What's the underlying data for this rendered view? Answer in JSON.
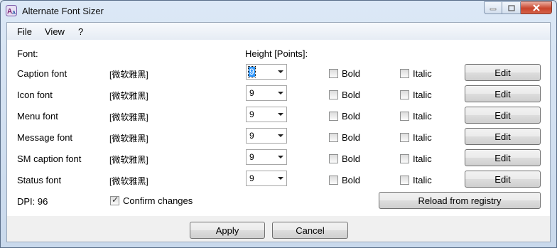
{
  "window": {
    "title": "Alternate Font Sizer"
  },
  "menu": {
    "file": "File",
    "view": "View",
    "help": "?"
  },
  "headers": {
    "font": "Font:",
    "height": "Height [Points]:"
  },
  "labels": {
    "bold": "Bold",
    "italic": "Italic",
    "edit": "Edit"
  },
  "rows": [
    {
      "label": "Caption font",
      "font": "[微软雅黑]",
      "height": "9",
      "bold": false,
      "italic": false
    },
    {
      "label": "Icon font",
      "font": "[微软雅黑]",
      "height": "9",
      "bold": false,
      "italic": false
    },
    {
      "label": "Menu font",
      "font": "[微软雅黑]",
      "height": "9",
      "bold": false,
      "italic": false
    },
    {
      "label": "Message font",
      "font": "[微软雅黑]",
      "height": "9",
      "bold": false,
      "italic": false
    },
    {
      "label": "SM caption font",
      "font": "[微软雅黑]",
      "height": "9",
      "bold": false,
      "italic": false
    },
    {
      "label": "Status font",
      "font": "[微软雅黑]",
      "height": "9",
      "bold": false,
      "italic": false
    }
  ],
  "dpi": "DPI: 96",
  "confirm": {
    "label": "Confirm changes",
    "checked": true
  },
  "buttons": {
    "reload": "Reload from registry",
    "apply": "Apply",
    "cancel": "Cancel"
  }
}
